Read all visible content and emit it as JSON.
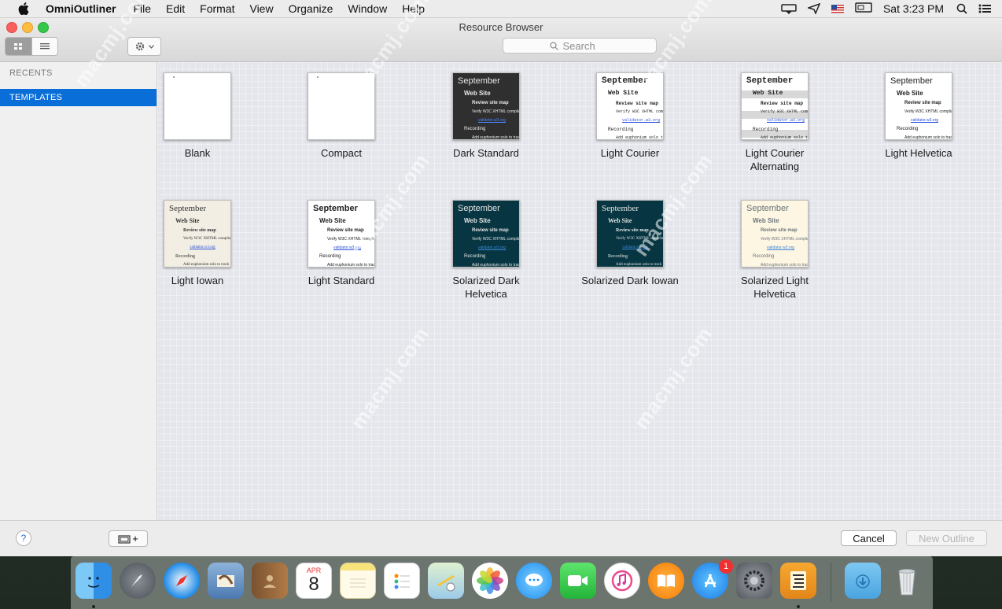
{
  "menubar": {
    "app_name": "OmniOutliner",
    "items": [
      "File",
      "Edit",
      "Format",
      "View",
      "Organize",
      "Window",
      "Help"
    ],
    "clock": "Sat 3:23 PM"
  },
  "window": {
    "title": "Resource Browser",
    "search": {
      "placeholder": "Search"
    }
  },
  "sidebar": {
    "recents_label": "RECENTS",
    "templates_label": "TEMPLATES"
  },
  "templates": [
    {
      "label": "Blank",
      "style": "blank"
    },
    {
      "label": "Compact",
      "style": "blank"
    },
    {
      "label": "Dark Standard",
      "style": "dark"
    },
    {
      "label": "Light Courier",
      "style": "courier"
    },
    {
      "label": "Light Courier\nAlternating",
      "style": "courier-alt"
    },
    {
      "label": "Light Helvetica",
      "style": "helvetica"
    },
    {
      "label": "Light Iowan",
      "style": "iowan"
    },
    {
      "label": "Light Standard",
      "style": "standard"
    },
    {
      "label": "Solarized Dark\nHelvetica",
      "style": "sol-dark"
    },
    {
      "label": "Solarized Dark Iowan",
      "style": "sol-dark-iowan"
    },
    {
      "label": "Solarized Light\nHelvetica",
      "style": "sol-light"
    }
  ],
  "thumb_text": {
    "heading": "September",
    "sub": "Web Site",
    "item1": "Review site map",
    "item2": "Verify W3C XHTML complian",
    "link": "validator.w3.org",
    "item3": "Recording",
    "item4": "Add euphonium solo to track"
  },
  "bottom": {
    "help_label": "?",
    "add_label": "+",
    "cancel_label": "Cancel",
    "new_outline_label": "New Outline"
  },
  "dock": {
    "calendar_month": "APR",
    "calendar_day": "8",
    "appstore_badge": "1"
  },
  "watermark": "macmj.com"
}
